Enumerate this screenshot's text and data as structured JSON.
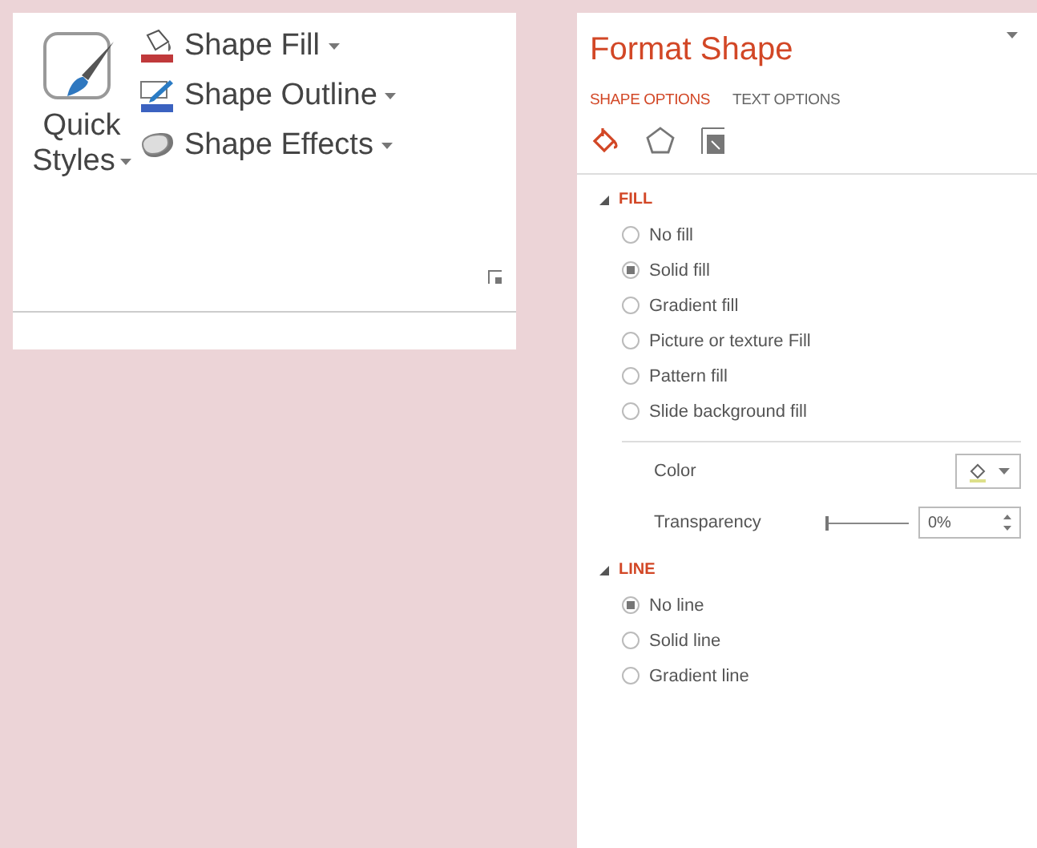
{
  "ribbon": {
    "quick_styles": {
      "label_1": "Quick",
      "label_2": "Styles"
    },
    "commands": [
      {
        "kind": "fill",
        "label": "Shape Fill"
      },
      {
        "kind": "outline",
        "label": "Shape Outline"
      },
      {
        "kind": "effects",
        "label": "Shape Effects"
      }
    ]
  },
  "pane": {
    "title": "Format Shape",
    "tabs": [
      {
        "label": "SHAPE OPTIONS",
        "selected": true
      },
      {
        "label": "TEXT OPTIONS",
        "selected": false
      }
    ],
    "icon_tabs": [
      {
        "kind": "fill",
        "selected": true
      },
      {
        "kind": "effects",
        "selected": false
      },
      {
        "kind": "size",
        "selected": false
      }
    ],
    "sections": [
      {
        "title": "FILL",
        "expanded": true,
        "options": [
          {
            "label": "No fill",
            "selected": false
          },
          {
            "label": "Solid fill",
            "selected": true
          },
          {
            "label": "Gradient fill",
            "selected": false
          },
          {
            "label": "Picture or texture Fill",
            "selected": false
          },
          {
            "label": "Pattern fill",
            "selected": false
          },
          {
            "label": "Slide background fill",
            "selected": false
          }
        ],
        "color": {
          "label": "Color"
        },
        "transparency": {
          "label": "Transparency",
          "level": 0,
          "value": "0%"
        }
      },
      {
        "title": "LINE",
        "expanded": true,
        "options": [
          {
            "label": "No line",
            "selected": true
          },
          {
            "label": "Solid line",
            "selected": false
          },
          {
            "label": "Gradient line",
            "selected": false
          }
        ]
      }
    ]
  }
}
